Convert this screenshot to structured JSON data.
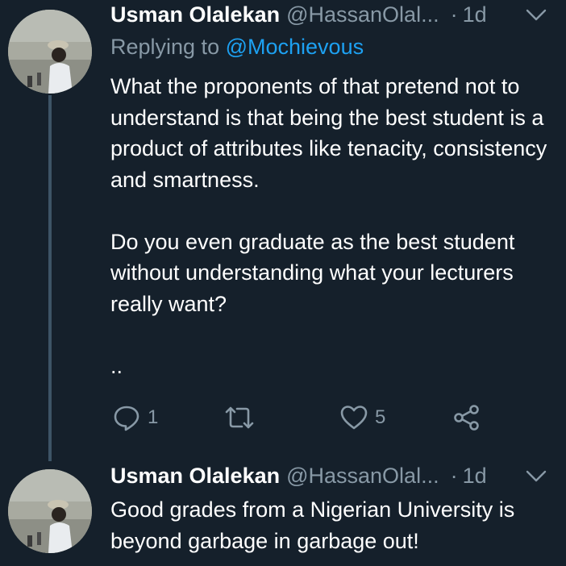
{
  "tweets": [
    {
      "name": "Usman Olalekan",
      "handle": "@HassanOlal...",
      "separator": "·",
      "time": "1d",
      "replying_prefix": "Replying to",
      "replying_to": "@Mochievous",
      "paragraphs": [
        "What the proponents of that pretend not to understand is that being the best student is a product of attributes like tenacity, consistency and smartness.",
        "Do you even graduate as the best student without understanding what your lecturers really want?",
        ".."
      ],
      "actions": {
        "reply_count": "1",
        "retweet_count": "",
        "like_count": "5"
      }
    },
    {
      "name": "Usman Olalekan",
      "handle": "@HassanOlal...",
      "separator": "·",
      "time": "1d",
      "paragraphs": [
        "Good grades from a Nigerian University is beyond garbage in garbage out!"
      ]
    }
  ],
  "colors": {
    "background": "#15202b",
    "primary_text": "#ffffff",
    "secondary_text": "#8899a6",
    "link": "#1da1f2",
    "thread_line": "#3d5466"
  },
  "icons": [
    "reply-icon",
    "retweet-icon",
    "like-icon",
    "share-icon",
    "chevron-down-icon"
  ]
}
